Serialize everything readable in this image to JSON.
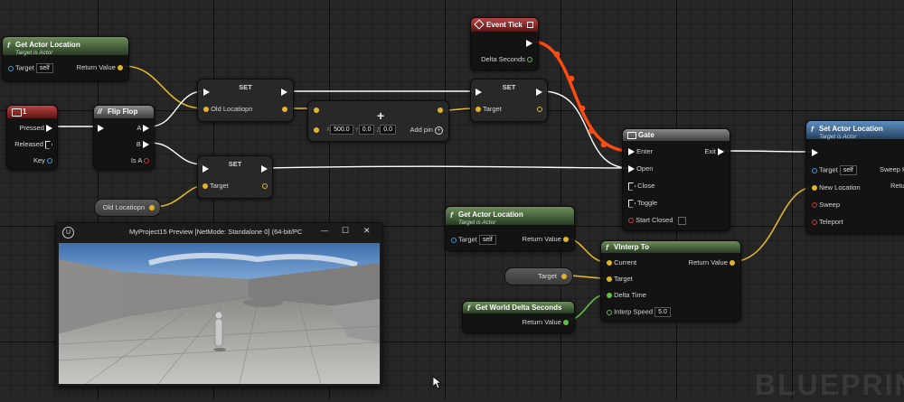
{
  "nodes": {
    "get_actor_location_1": {
      "title": "Get Actor Location",
      "subtitle": "Target is Actor",
      "target_label": "Target",
      "target_value": "self",
      "output_label": "Return Value"
    },
    "key_1": {
      "title": "1",
      "pressed": "Pressed",
      "released": "Released",
      "key": "Key"
    },
    "flip_flop": {
      "title": "Flip Flop",
      "a": "A",
      "b": "B",
      "is_a": "Is A"
    },
    "set_1": {
      "title": "SET",
      "pin_label": "Old Locatiopn"
    },
    "make_vector": {
      "x_label": "X",
      "x": "500.0",
      "y_label": "Y",
      "y": "0.0",
      "z_label": "Z",
      "z": "0.0",
      "add_pin": "Add pin"
    },
    "set_2": {
      "title": "SET",
      "target_label": "Target"
    },
    "set_3": {
      "title": "SET",
      "target_label": "Target"
    },
    "old_location_var": {
      "label": "Old Locatiopn"
    },
    "event_tick": {
      "title": "Event Tick",
      "delta": "Delta Seconds"
    },
    "gate": {
      "title": "Gate",
      "enter": "Enter",
      "exit": "Exit",
      "open": "Open",
      "close": "Close",
      "toggle": "Toggle",
      "start_closed": "Start Closed"
    },
    "set_actor_location": {
      "title": "Set Actor Location",
      "subtitle": "Target is Actor",
      "target_label": "Target",
      "target_value": "self",
      "new_location": "New Location",
      "sweep": "Sweep",
      "teleport": "Teleport",
      "sweep_hit": "Sweep H",
      "return_short": "Retu"
    },
    "get_actor_location_2": {
      "title": "Get Actor Location",
      "subtitle": "Target is Actor",
      "target_label": "Target",
      "target_value": "self",
      "output_label": "Return Value"
    },
    "vinterp": {
      "title": "VInterp To",
      "current": "Current",
      "target": "Target",
      "delta_time": "Delta Time",
      "interp_speed": "Interp Speed",
      "interp_value": "5.0",
      "output_label": "Return Value"
    },
    "target_var": {
      "label": "Target"
    },
    "get_world_delta": {
      "title": "Get World Delta Seconds",
      "output_label": "Return Value"
    }
  },
  "preview_window": {
    "title": "MyProject15 Preview [NetMode: Standalone 0]  (64-bit/PC",
    "logo": "U",
    "minimize": "—",
    "maximize": "☐",
    "close": "✕"
  },
  "watermark": "BLUEPRINT",
  "colors": {
    "exec_wire": "#ffffff",
    "vector_wire": "#e0b52a",
    "float_wire": "#60c040",
    "object_wire": "#3e9ad8",
    "highlight_wire": "#ff4a14"
  }
}
